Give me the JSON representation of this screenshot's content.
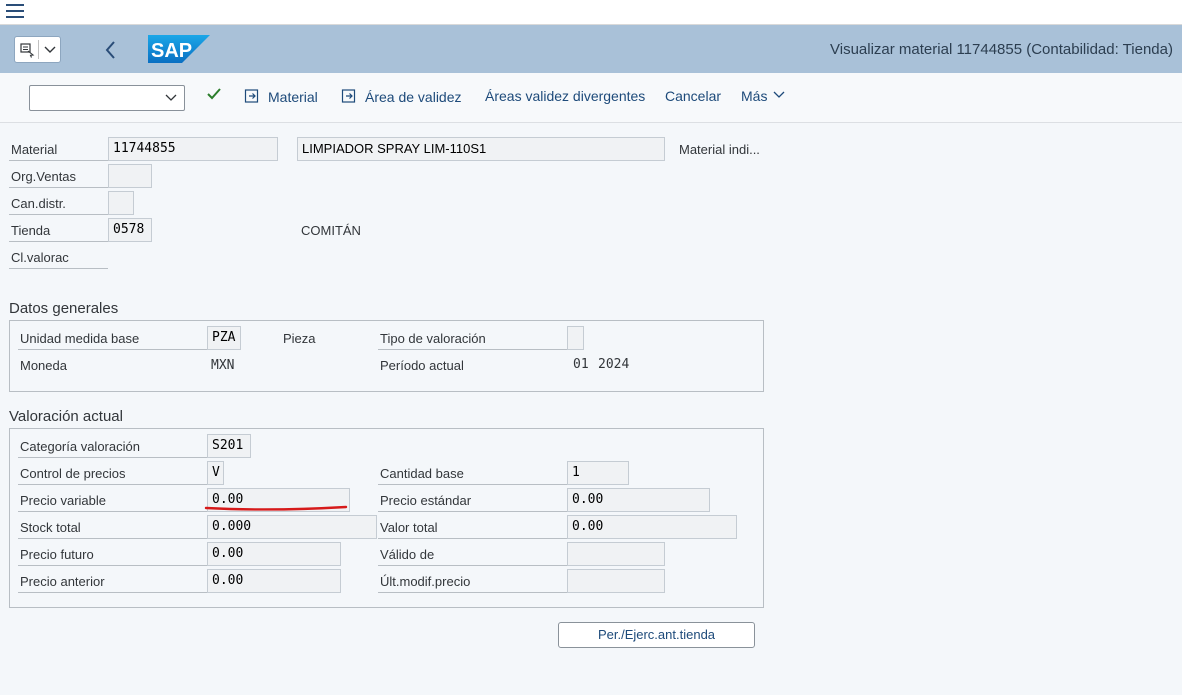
{
  "window": {
    "title": "Visualizar material 11744855 (Contabilidad: Tienda)"
  },
  "toolbar": {
    "select_value": "",
    "material_label": "Material",
    "area_validez_label": "Área de validez",
    "areas_divergentes_label": "Áreas validez divergentes",
    "cancelar_label": "Cancelar",
    "mas_label": "Más"
  },
  "header": {
    "material_label": "Material",
    "material_value": "11744855",
    "material_desc": "LIMPIADOR SPRAY LIM-110S1",
    "material_ind_label": "Material indi...",
    "org_ventas_label": "Org.Ventas",
    "org_ventas_value": "",
    "can_distr_label": "Can.distr.",
    "can_distr_value": "",
    "tienda_label": "Tienda",
    "tienda_value": "0578",
    "tienda_name": "COMITÁN",
    "cl_valorac_label": "Cl.valorac"
  },
  "datos_generales": {
    "title": "Datos generales",
    "unidad_label": "Unidad medida base",
    "unidad_value": "PZA",
    "unidad_desc": "Pieza",
    "tipo_val_label": "Tipo de valoración",
    "tipo_val_value": "",
    "moneda_label": "Moneda",
    "moneda_value": "MXN",
    "periodo_label": "Período actual",
    "periodo_mes": "01",
    "periodo_anio": "2024"
  },
  "valoracion": {
    "title": "Valoración actual",
    "categoria_label": "Categoría valoración",
    "categoria_value": "S201",
    "control_label": "Control de precios",
    "control_value": "V",
    "cantidad_base_label": "Cantidad base",
    "cantidad_base_value": "1",
    "precio_variable_label": "Precio variable",
    "precio_variable_value": "0.00",
    "precio_estandar_label": "Precio estándar",
    "precio_estandar_value": "0.00",
    "stock_total_label": "Stock total",
    "stock_total_value": "0.000",
    "valor_total_label": "Valor total",
    "valor_total_value": "0.00",
    "precio_futuro_label": "Precio futuro",
    "precio_futuro_value": "0.00",
    "valido_de_label": "Válido de",
    "valido_de_value": "",
    "precio_anterior_label": "Precio anterior",
    "precio_anterior_value": "0.00",
    "ult_modif_label": "Últ.modif.precio",
    "ult_modif_value": ""
  },
  "footer": {
    "per_button_label": "Per./Ejerc.ant.tienda"
  },
  "colors": {
    "shell": "#a9c1d8",
    "accent": "#1d4a7a",
    "annotation": "#d61a1a",
    "check": "#2b7d2b"
  }
}
